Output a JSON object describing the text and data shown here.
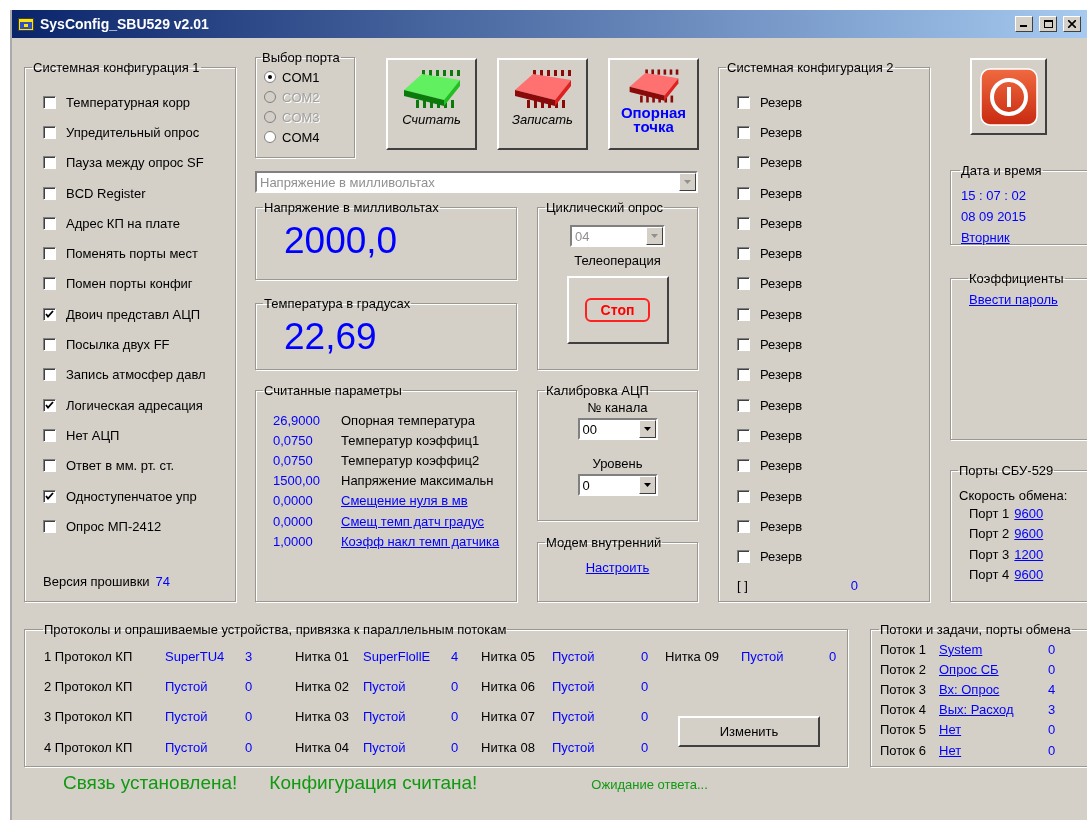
{
  "window": {
    "title": "SysConfig_SBU529 v2.01"
  },
  "config1": {
    "title": "Системная конфигурация 1",
    "items": [
      {
        "label": "Температурная корр",
        "checked": false
      },
      {
        "label": "Упредительный опрос",
        "checked": false
      },
      {
        "label": "Пауза между опрос SF",
        "checked": false
      },
      {
        "label": "BCD Register",
        "checked": false
      },
      {
        "label": "Адрес КП на плате",
        "checked": false
      },
      {
        "label": "Поменять порты мест",
        "checked": false
      },
      {
        "label": "Помен порты  конфиг",
        "checked": false
      },
      {
        "label": "Двоич представл АЦП",
        "checked": true
      },
      {
        "label": "Посылка двух FF",
        "checked": false
      },
      {
        "label": "Запись атмосфер давл",
        "checked": false
      },
      {
        "label": "Логическая адресация",
        "checked": true
      },
      {
        "label": "Нет АЦП",
        "checked": false
      },
      {
        "label": "Ответ в мм. рт. ст.",
        "checked": false
      },
      {
        "label": "Одноступенчатое упр",
        "checked": true
      },
      {
        "label": "Опрос МП-2412",
        "checked": false
      }
    ],
    "firmware_label": "Версия прошивки",
    "firmware_value": "74"
  },
  "port": {
    "title": "Выбор порта",
    "options": [
      {
        "label": "COM1",
        "selected": true,
        "disabled": false
      },
      {
        "label": "COM2",
        "selected": false,
        "disabled": true
      },
      {
        "label": "COM3",
        "selected": false,
        "disabled": true
      },
      {
        "label": "COM4",
        "selected": false,
        "disabled": false
      }
    ]
  },
  "actions": [
    {
      "label": "Считать",
      "kind": "read"
    },
    {
      "label": "Записать",
      "kind": "write"
    },
    {
      "label": "Опорная точка",
      "kind": "reference"
    }
  ],
  "measure_select": {
    "value": "Напряжение в милливольтах",
    "disabled": true
  },
  "voltage": {
    "title": "Напряжение в милливольтах",
    "value": "2000,0"
  },
  "temperature": {
    "title": "Температура в градусах",
    "value": "22,69"
  },
  "params": {
    "title": "Считанные параметры",
    "rows": [
      {
        "value": "26,9000",
        "label": "Опорная температура",
        "link": false
      },
      {
        "value": "0,0750",
        "label": "Температур коэффиц1",
        "link": false
      },
      {
        "value": "0,0750",
        "label": "Температур коэффиц2",
        "link": false
      },
      {
        "value": "1500,00",
        "label": "Напряжение максимальн",
        "link": false
      },
      {
        "value": "0,0000",
        "label": "Смещение нуля в мв",
        "link": true
      },
      {
        "value": "0,0000",
        "label": "Смещ темп датч градус",
        "link": true
      },
      {
        "value": "1,0000",
        "label": "Коэфф накл темп датчика",
        "link": true
      }
    ]
  },
  "cyclic": {
    "title": "Циклический опрос",
    "select": {
      "value": "04",
      "disabled": true
    },
    "label": "Телеоперация",
    "button": "Стоп"
  },
  "calibration": {
    "title": "Калибровка АЦП",
    "channel_label": "№ канала",
    "channel_value": "00",
    "level_label": "Уровень",
    "level_value": "0"
  },
  "modem": {
    "title": "Модем внутренний",
    "link": "Настроить"
  },
  "config2": {
    "title": "Системная конфигурация 2",
    "items": [
      {
        "label": "Резерв",
        "checked": false
      },
      {
        "label": "Резерв",
        "checked": false
      },
      {
        "label": "Резерв",
        "checked": false
      },
      {
        "label": "Резерв",
        "checked": false
      },
      {
        "label": "Резерв",
        "checked": false
      },
      {
        "label": "Резерв",
        "checked": false
      },
      {
        "label": "Резерв",
        "checked": false
      },
      {
        "label": "Резерв",
        "checked": false
      },
      {
        "label": "Резерв",
        "checked": false
      },
      {
        "label": "Резерв",
        "checked": false
      },
      {
        "label": "Резерв",
        "checked": false
      },
      {
        "label": "Резерв",
        "checked": false
      },
      {
        "label": "Резерв",
        "checked": false
      },
      {
        "label": "Резерв",
        "checked": false
      },
      {
        "label": "Резерв",
        "checked": false
      },
      {
        "label": "Резерв",
        "checked": false
      }
    ],
    "footer_label": "[ ]",
    "footer_value": "0"
  },
  "datetime": {
    "title": "Дата и время",
    "time": "15 : 07 : 02",
    "date": "08 09 2015",
    "weekday": "Вторник"
  },
  "coefficients": {
    "title": "Коэффициенты",
    "link": "Ввести пароль"
  },
  "ports": {
    "title": "Порты СБУ-529",
    "subtitle": "Скорость обмена:",
    "rows": [
      {
        "label": "Порт 1",
        "value": "9600"
      },
      {
        "label": "Порт 2",
        "value": "9600"
      },
      {
        "label": "Порт 3",
        "value": "1200"
      },
      {
        "label": "Порт 4",
        "value": "9600"
      }
    ]
  },
  "protocols": {
    "title": "Протоколы и опрашиваемые устройства, привязка к параллельным потокам",
    "protocol_rows": [
      {
        "label": "1 Протокол  КП",
        "name": "SuperTU4",
        "count": "3"
      },
      {
        "label": "2 Протокол  КП",
        "name": "Пустой",
        "count": "0"
      },
      {
        "label": "3 Протокол  КП",
        "name": "Пустой",
        "count": "0"
      },
      {
        "label": "4 Протокол  КП",
        "name": "Пустой",
        "count": "0"
      }
    ],
    "threads": [
      {
        "label": "Нитка 01",
        "name": "SuperFlollE",
        "count": "4"
      },
      {
        "label": "Нитка 02",
        "name": "Пустой",
        "count": "0"
      },
      {
        "label": "Нитка 03",
        "name": "Пустой",
        "count": "0"
      },
      {
        "label": "Нитка 04",
        "name": "Пустой",
        "count": "0"
      },
      {
        "label": "Нитка 05",
        "name": "Пустой",
        "count": "0"
      },
      {
        "label": "Нитка 06",
        "name": "Пустой",
        "count": "0"
      },
      {
        "label": "Нитка 07",
        "name": "Пустой",
        "count": "0"
      },
      {
        "label": "Нитка 08",
        "name": "Пустой",
        "count": "0"
      },
      {
        "label": "Нитка 09",
        "name": "Пустой",
        "count": "0"
      }
    ],
    "button": "Изменить"
  },
  "streams": {
    "title": "Потоки и задачи, порты обмена",
    "rows": [
      {
        "label": "Поток 1",
        "name": "System",
        "count": "0"
      },
      {
        "label": "Поток 2",
        "name": "Опрос СБ",
        "count": "0"
      },
      {
        "label": "Поток 3",
        "name": "Вх: Опрос",
        "count": "4"
      },
      {
        "label": "Поток 4",
        "name": "Вых: Расход",
        "count": "3"
      },
      {
        "label": "Поток 5",
        "name": "Нет",
        "count": "0"
      },
      {
        "label": "Поток 6",
        "name": "Нет",
        "count": "0"
      }
    ]
  },
  "status": [
    {
      "text": "Связь установлена!",
      "kind": "large"
    },
    {
      "text": "Конфигурация считана!",
      "kind": "large"
    },
    {
      "text": "Ожидание ответа...",
      "kind": "small"
    }
  ]
}
